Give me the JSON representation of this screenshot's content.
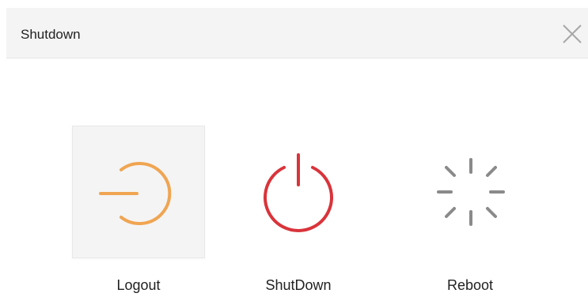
{
  "dialog": {
    "title": "Shutdown",
    "close_icon": "close-icon"
  },
  "options": [
    {
      "label": "Logout",
      "icon": "logout-icon",
      "color": "#f0a552",
      "selected": true
    },
    {
      "label": "ShutDown",
      "icon": "power-icon",
      "color": "#d9343b",
      "selected": false
    },
    {
      "label": "Reboot",
      "icon": "reboot-spinner-icon",
      "color": "#8a8a8a",
      "selected": false
    }
  ]
}
